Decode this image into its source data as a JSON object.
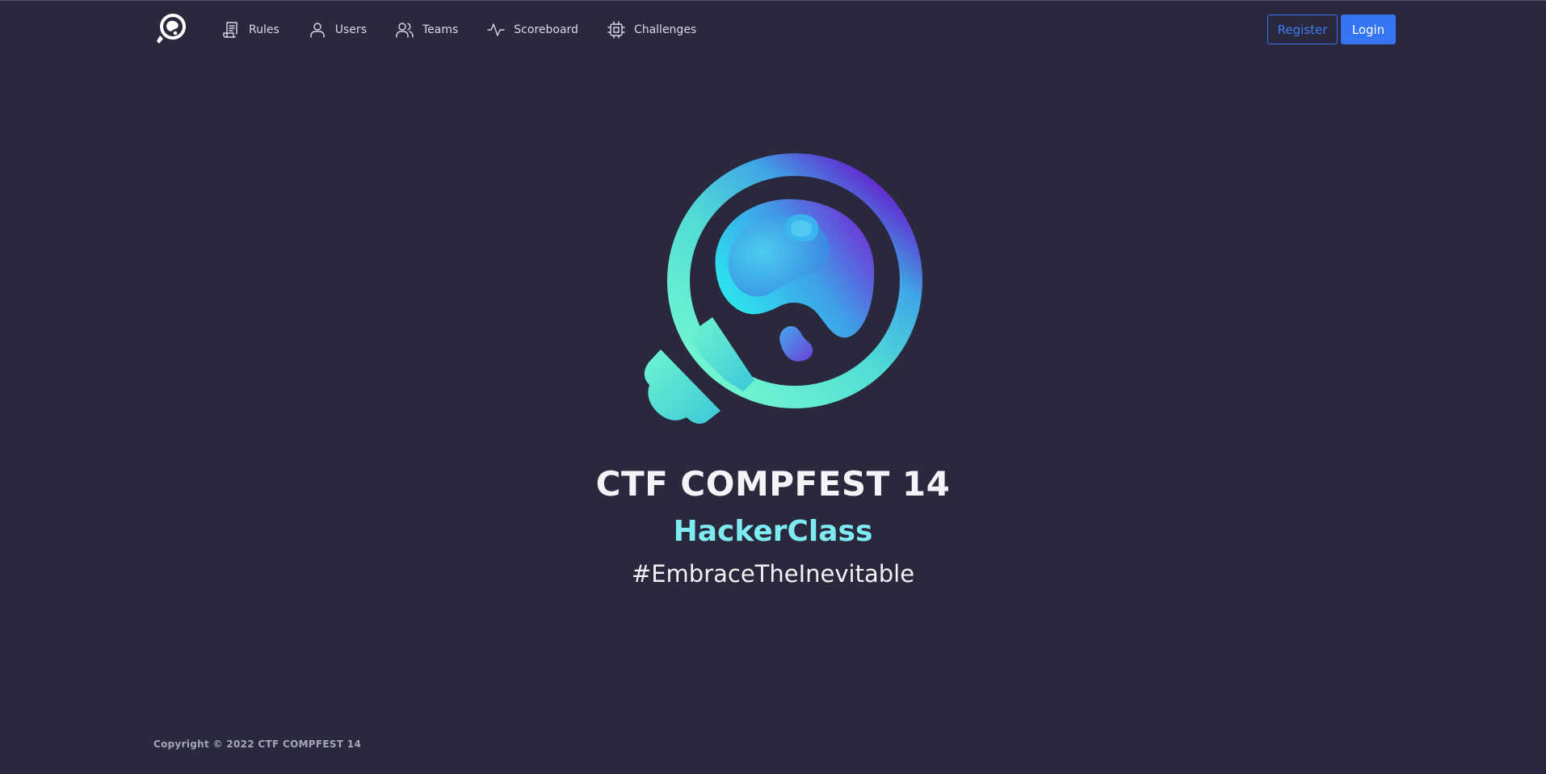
{
  "navbar": {
    "brand_icon": "compfest-logo-icon",
    "links": [
      {
        "label": "Rules",
        "icon": "scroll-icon"
      },
      {
        "label": "Users",
        "icon": "user-icon"
      },
      {
        "label": "Teams",
        "icon": "users-icon"
      },
      {
        "label": "Scoreboard",
        "icon": "activity-icon"
      },
      {
        "label": "Challenges",
        "icon": "cpu-icon"
      }
    ],
    "register_label": "Register",
    "login_label": "Login"
  },
  "hero": {
    "logo_icon": "compfest-logo",
    "title": "CTF COMPFEST 14",
    "subtitle": "HackerClass",
    "tagline": "#EmbraceTheInevitable"
  },
  "footer": {
    "copyright": "Copyright © 2022 CTF COMPFEST 14"
  },
  "colors": {
    "background": "#29283c",
    "accent_blue": "#3574f5",
    "subtitle_cyan": "#7eeaf2",
    "logo_green": "#6ff5cf",
    "logo_purple": "#6a2fd3"
  }
}
